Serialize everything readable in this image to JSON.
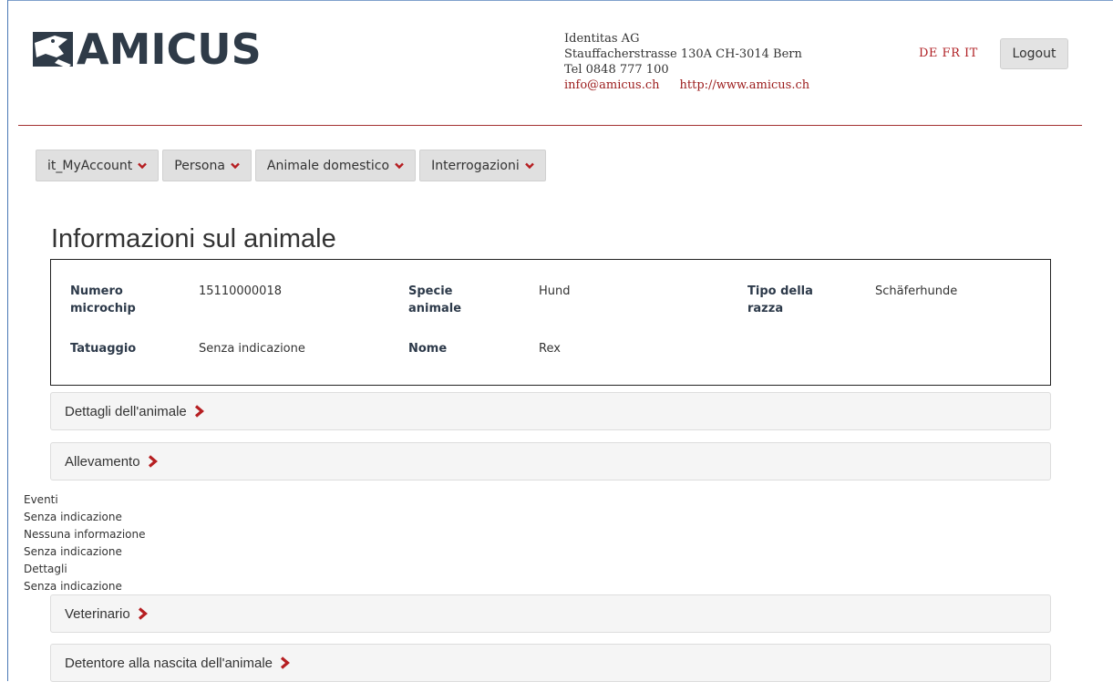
{
  "brand": {
    "name": "AMICUS"
  },
  "contact": {
    "company": "Identitas AG",
    "address": "Stauffacherstrasse 130A CH-3014 Bern",
    "phone": "Tel 0848 777 100",
    "email": "info@amicus.ch",
    "website": "http://www.amicus.ch"
  },
  "languages": "DE FR IT",
  "logout_label": "Logout",
  "nav": {
    "items": [
      {
        "label": "it_MyAccount"
      },
      {
        "label": "Persona"
      },
      {
        "label": "Animale domestico"
      },
      {
        "label": "Interrogazioni"
      }
    ]
  },
  "page": {
    "title": "Informazioni sul animale"
  },
  "animal_info": {
    "microchip_label_1": "Numero",
    "microchip_label_2": "microchip",
    "microchip_value": "15110000018",
    "species_label_1": "Specie",
    "species_label_2": "animale",
    "species_value": "Hund",
    "breed_label_1": "Tipo della",
    "breed_label_2": "razza",
    "breed_value": "Schäferhunde",
    "tattoo_label": "Tatuaggio",
    "tattoo_value": "Senza indicazione",
    "name_label": "Nome",
    "name_value": "Rex"
  },
  "panels": {
    "details": "Dettagli dell'animale",
    "breeding": "Allevamento",
    "vet": "Veterinario",
    "owner_birth": "Detentore alla nascita dell'animale"
  },
  "events": {
    "lines": [
      "Eventi",
      "Senza indicazione",
      "Nessuna informazione",
      "Senza indicazione",
      "Dettagli",
      "Senza indicazione"
    ]
  },
  "colors": {
    "accent": "#b61e21",
    "brand_dark": "#2f3b48",
    "nav_bg": "#e0e0e0",
    "panel_bg": "#f5f5f5"
  },
  "icons": {
    "chevron_nav": "chevron-down-icon",
    "chevron_panel": "chevron-right-icon",
    "logo": "dog-logo-icon"
  }
}
